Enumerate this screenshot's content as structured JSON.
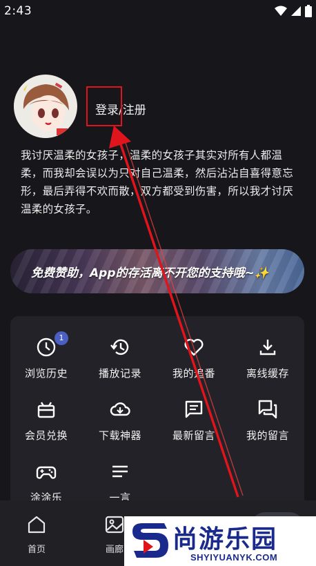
{
  "status_bar": {
    "time": "2:43",
    "icons": [
      "wifi-icon",
      "signal-icon",
      "battery-icon"
    ]
  },
  "profile": {
    "login_label": "登录/注册",
    "bio": "我讨厌温柔的女孩子，温柔的女孩子其实对所有人都温柔，而我却会误以为只对自己温柔，然后沾沾自喜得意忘形，最后弄得不欢而散，双方都受到伤害，所以我才讨厌温柔的女孩子。"
  },
  "banner": {
    "text": "免费赞助，App的存活离不开您的支持哦~✨"
  },
  "menu": {
    "items": [
      {
        "label": "浏览历史",
        "icon": "clock-icon",
        "badge": "1"
      },
      {
        "label": "播放记录",
        "icon": "history-icon"
      },
      {
        "label": "我的追番",
        "icon": "heart-icon"
      },
      {
        "label": "离线缓存",
        "icon": "download-icon"
      },
      {
        "label": "会员兑换",
        "icon": "gift-icon"
      },
      {
        "label": "下载神器",
        "icon": "cloud-download-icon"
      },
      {
        "label": "最新留言",
        "icon": "message-icon"
      },
      {
        "label": "我的留言",
        "icon": "forum-icon"
      },
      {
        "label": "涂涂乐",
        "icon": "gamepad-icon"
      },
      {
        "label": "一言",
        "icon": "lines-icon"
      }
    ]
  },
  "bottom_nav": {
    "items": [
      {
        "label": "首页",
        "icon": "home-icon"
      },
      {
        "label": "画廊",
        "icon": "image-icon"
      }
    ]
  },
  "watermark": {
    "brand": "尚游乐园",
    "url": "SHYIYUANYK.COM"
  },
  "colors": {
    "background": "#17171b",
    "card": "#222228",
    "badge": "#4a5fc1",
    "annotation": "#e0141c",
    "watermark": "#1a2a8c"
  }
}
